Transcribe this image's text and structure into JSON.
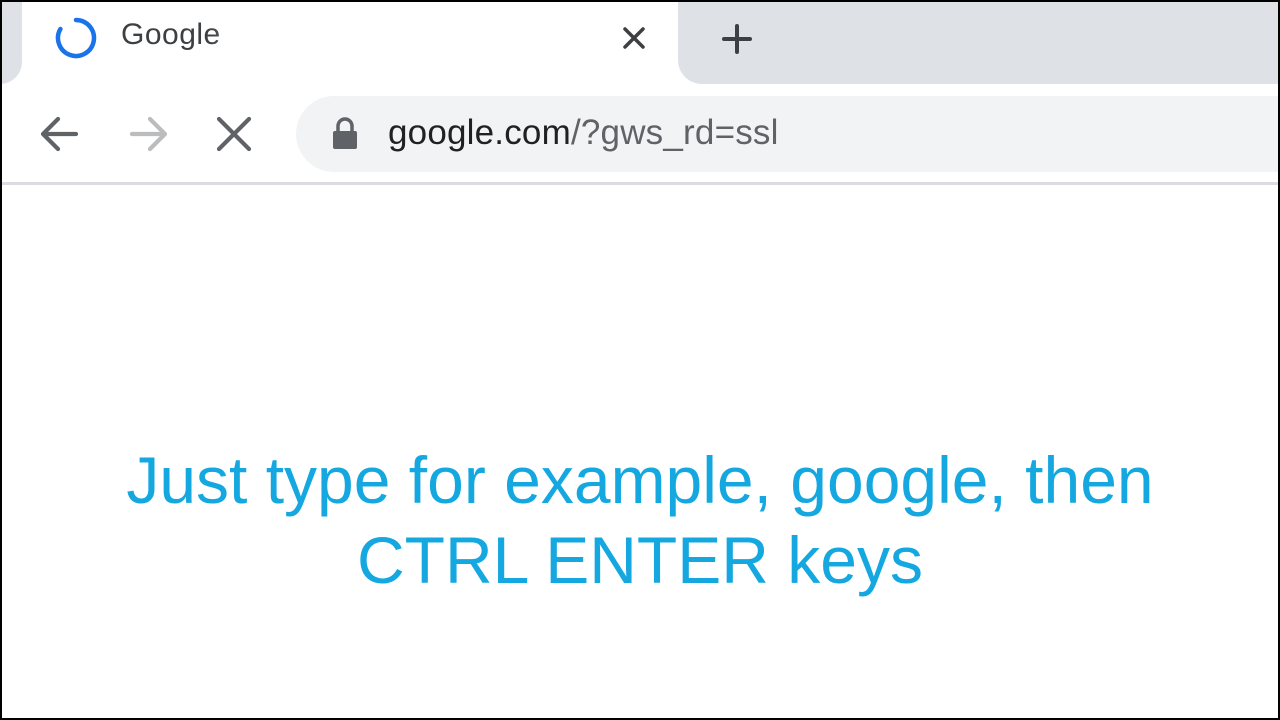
{
  "browser": {
    "tab": {
      "title": "Google",
      "close_icon": "close-icon",
      "loading_icon": "loading-spinner-icon"
    },
    "new_tab_icon": "plus-icon",
    "nav": {
      "back_icon": "arrow-left-icon",
      "forward_icon": "arrow-right-icon",
      "stop_icon": "close-icon"
    },
    "address_bar": {
      "lock_icon": "lock-icon",
      "url_host": "google.com",
      "url_rest": "/?gws_rd=ssl"
    },
    "colors": {
      "tabstrip": "#dee1e6",
      "omnibox": "#f1f3f4",
      "spinner": "#1a73e8",
      "caption": "#15a8e0"
    }
  },
  "overlay": {
    "line1": "Just type for example, google, then",
    "line2": "CTRL ENTER keys"
  }
}
